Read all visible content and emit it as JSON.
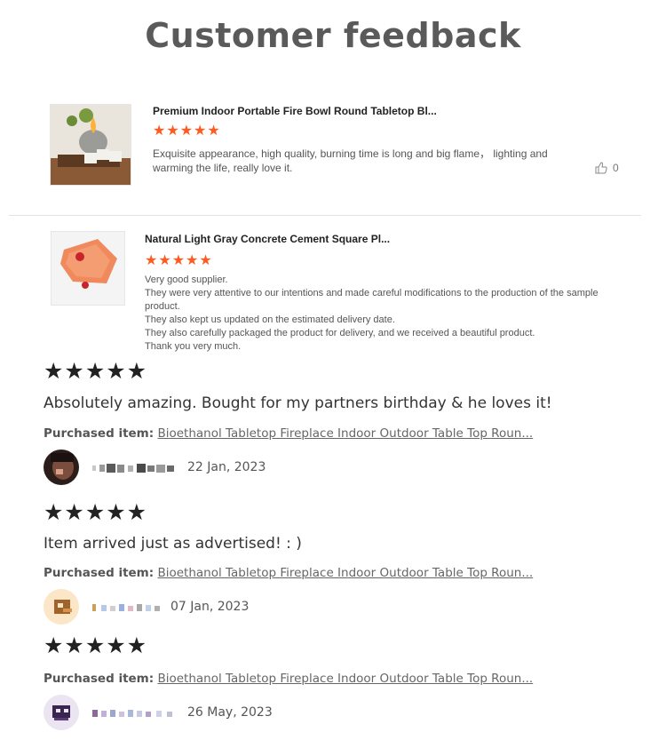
{
  "page": {
    "title": "Customer feedback"
  },
  "reviews_top": [
    {
      "product_title": "Premium Indoor Portable Fire Bowl Round Tabletop Bl...",
      "stars": "★★★★★",
      "text": "Exquisite appearance, high quality, burning time is long and big flame， lighting and warming the life, really love it.",
      "likes": "0"
    },
    {
      "product_title": "Natural Light Gray Concrete Cement Square Pl...",
      "stars": "★★★★★",
      "lines": [
        "Very good supplier.",
        "They were very attentive to our intentions and made careful modifications to the production of the sample product.",
        "They also kept us updated on the estimated delivery date.",
        "They also carefully packaged the product for delivery, and we received a beautiful product.",
        "Thank you very much."
      ]
    }
  ],
  "reviews_bottom": [
    {
      "stars": "★★★★★",
      "text": "Absolutely amazing. Bought for my partners birthday & he loves it!",
      "purchased_label": "Purchased item:",
      "purchased_link": "Bioethanol Tabletop Fireplace Indoor Outdoor Table Top Roun...",
      "date": "22 Jan, 2023"
    },
    {
      "stars": "★★★★★",
      "text": "Item arrived just as advertised! : )",
      "purchased_label": "Purchased item:",
      "purchased_link": "Bioethanol Tabletop Fireplace Indoor Outdoor Table Top Roun...",
      "date": "07 Jan, 2023"
    },
    {
      "stars": "★★★★★",
      "purchased_label": "Purchased item:",
      "purchased_link": "Bioethanol Tabletop Fireplace Indoor Outdoor Table Top Roun...",
      "date": "26 May, 2023"
    }
  ],
  "colors": {
    "star_orange": "#ff5a1f",
    "star_black": "#222222",
    "title_gray": "#5a5a5a"
  }
}
